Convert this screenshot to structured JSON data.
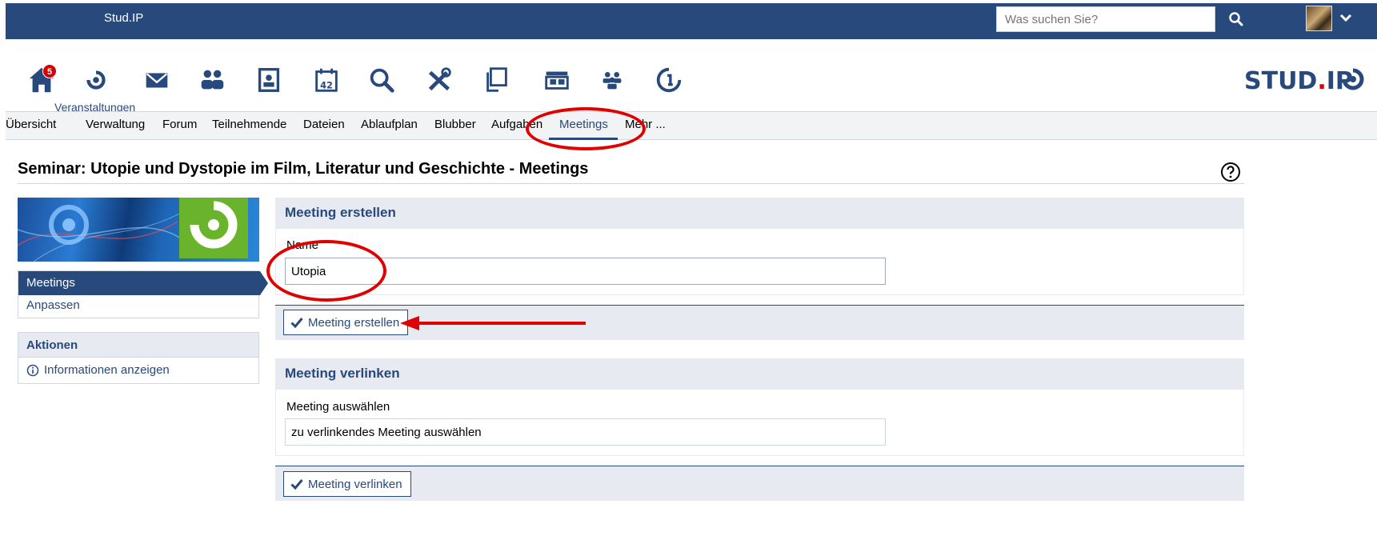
{
  "topbar": {
    "brand": "Stud.IP",
    "search_placeholder": "Was suchen Sie?"
  },
  "iconnav": {
    "home_badge": "5",
    "active_label": "Veranstaltungen",
    "calendar_day": "42",
    "logo_text_1": "STUD",
    "logo_dot": ".",
    "logo_text_2": "IP"
  },
  "tabs": [
    {
      "label": "Übersicht"
    },
    {
      "label": "Verwaltung"
    },
    {
      "label": "Forum"
    },
    {
      "label": "Teilnehmende"
    },
    {
      "label": "Dateien"
    },
    {
      "label": "Ablaufplan"
    },
    {
      "label": "Blubber"
    },
    {
      "label": "Aufgaben"
    },
    {
      "label": "Meetings"
    },
    {
      "label": "Mehr ..."
    }
  ],
  "page": {
    "title": "Seminar: Utopie und Dystopie im Film, Literatur und Geschichte - Meetings"
  },
  "sidebar": {
    "nav_items": [
      {
        "label": "Meetings"
      },
      {
        "label": "Anpassen"
      }
    ],
    "actions_title": "Aktionen",
    "actions": [
      {
        "label": "Informationen anzeigen"
      }
    ]
  },
  "create_panel": {
    "title": "Meeting erstellen",
    "name_label": "Name",
    "name_value": "Utopia",
    "submit_label": "Meeting erstellen"
  },
  "link_panel": {
    "title": "Meeting verlinken",
    "select_label": "Meeting auswählen",
    "select_value": "zu verlinkendes Meeting auswählen",
    "submit_label": "Meeting verlinken"
  },
  "colors": {
    "brand_blue": "#28497c",
    "panel_bg": "#e7ebf1",
    "badge_red": "#d60000",
    "annotation_red": "#e00000"
  }
}
